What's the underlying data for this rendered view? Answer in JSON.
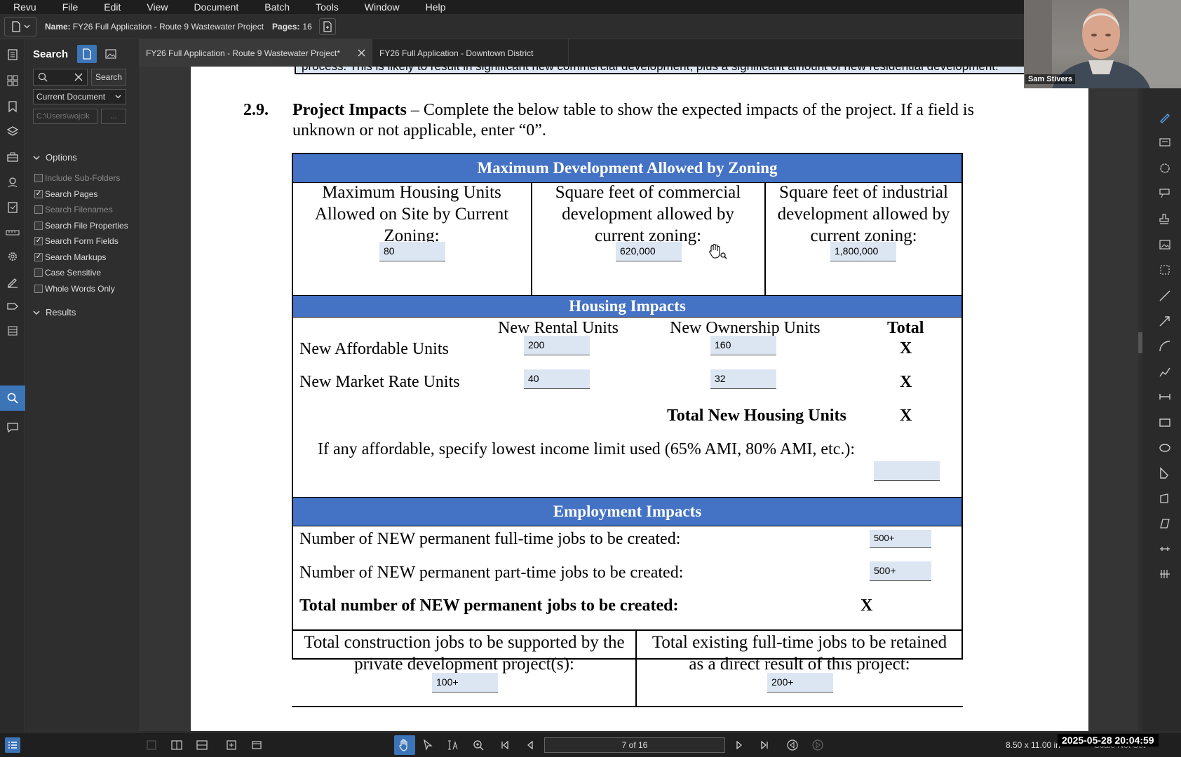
{
  "menubar": {
    "items": [
      "Revu",
      "File",
      "Edit",
      "View",
      "Document",
      "Batch",
      "Tools",
      "Window",
      "Help"
    ]
  },
  "infobar": {
    "name_label": "Name:",
    "name_value": "FY26 Full Application - Route 9 Wastewater Project",
    "pages_label": "Pages:",
    "pages_value": "16"
  },
  "panel": {
    "title": "Search",
    "search_button": "Search",
    "scope": "Current Document",
    "path_placeholder": "C:\\Users\\wojcik",
    "path_button": "...",
    "options_label": "Options",
    "options": [
      {
        "label": "Include Sub-Folders",
        "checked": false,
        "enabled": false
      },
      {
        "label": "Search Pages",
        "checked": true,
        "enabled": true
      },
      {
        "label": "Search Filenames",
        "checked": false,
        "enabled": false
      },
      {
        "label": "Search File Properties",
        "checked": false,
        "enabled": true
      },
      {
        "label": "Search Form Fields",
        "checked": true,
        "enabled": true
      },
      {
        "label": "Search Markups",
        "checked": true,
        "enabled": true
      },
      {
        "label": "Case Sensitive",
        "checked": false,
        "enabled": true
      },
      {
        "label": "Whole Words Only",
        "checked": false,
        "enabled": true
      }
    ],
    "results_label": "Results"
  },
  "tabs": [
    {
      "label": "FY26 Full Application - Route 9 Wastewater Project*",
      "active": true
    },
    {
      "label": "FY26 Full Application - Downtown District",
      "active": false
    }
  ],
  "page": {
    "top_text": "process. This is likely to result in significant new commercial development, plus a significant amount of new residential development.",
    "section_num": "2.9.",
    "section_title": "Project Impacts",
    "section_line1": " – Complete the below table to show the expected impacts of the project. If a field is",
    "section_line2": "unknown or not applicable, enter “0”.",
    "zoning": {
      "header": "Maximum Development Allowed by Zoning",
      "col1": "Maximum Housing Units Allowed on Site by Current Zoning:",
      "col1_value": "80",
      "col2": "Square feet of commercial development allowed by current zoning:",
      "col2_value": "620,000",
      "col3": "Square feet of industrial development allowed by current zoning:",
      "col3_value": "1,800,000"
    },
    "housing": {
      "header": "Housing Impacts",
      "col_rental": "New Rental Units",
      "col_ownership": "New Ownership Units",
      "col_total": "Total",
      "row1_label": "New Affordable Units",
      "row1_rental": "200",
      "row1_ownership": "160",
      "row1_total": "X",
      "row2_label": "New Market Rate Units",
      "row2_rental": "40",
      "row2_ownership": "32",
      "row2_total": "X",
      "total_label": "Total New Housing Units",
      "total_value": "X",
      "income_label": "If any affordable, specify lowest income limit used (65% AMI, 80% AMI, etc.):",
      "income_value": ""
    },
    "employment": {
      "header": "Employment Impacts",
      "fulltime_label": "Number of NEW permanent full-time jobs to be created:",
      "fulltime_value": "500+",
      "parttime_label": "Number of NEW permanent part-time jobs to be created:",
      "parttime_value": "500+",
      "total_label": "Total number of NEW permanent jobs to be created:",
      "total_value": "X",
      "construction_label": "Total construction jobs to be supported by the private development project(s):",
      "construction_value": "100+",
      "retained_label": "Total existing full-time jobs to be retained as a direct result of this project:",
      "retained_value": "200+"
    }
  },
  "statusbar": {
    "page_indicator": "7 of 16",
    "page_size": "8.50 x 11.00 in",
    "scale": "Scale Not Set",
    "timestamp": "2025-05-28 20:04:59"
  },
  "webcam": {
    "name": "Sam Stivers"
  },
  "colors": {
    "accent": "#3c74b8",
    "table_header": "#4472c4",
    "form_field": "#dce6f2"
  }
}
